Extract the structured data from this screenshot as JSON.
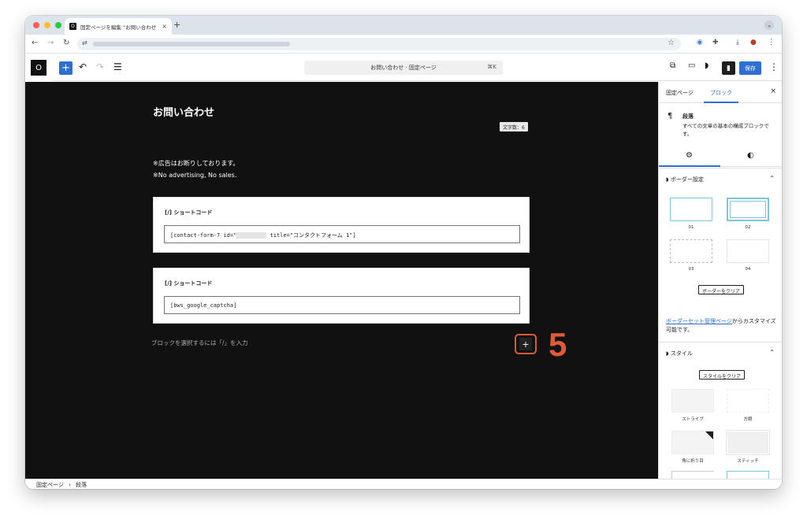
{
  "browser": {
    "tab_title": "固定ページを編集 “お問い合わせ",
    "tab_favicon": "O",
    "new_tab": "+",
    "close_tab": "×"
  },
  "editor": {
    "site_logo": "O",
    "add_block": "+",
    "command_bar": "お問い合わせ · 固定ページ",
    "command_shortcut": "⌘K",
    "save_label": "保存",
    "sidebar_toggle": "▮"
  },
  "canvas": {
    "page_title": "お問い合わせ",
    "word_count": "文字数：6",
    "notice_jp": "※広告はお断りしております。",
    "notice_en": "※No advertising, No sales.",
    "shortcode_blocks": [
      {
        "label": "[/] ショートコード",
        "value_pre": "[contact-form-7 id=\"",
        "value_post": " title=\"コンタクトフォーム 1\"]"
      },
      {
        "label": "[/] ショートコード",
        "value_pre": "[bws_google_captcha]",
        "value_post": ""
      }
    ],
    "block_placeholder": "ブロックを選択するには「/」を入力",
    "inserter_plus": "+",
    "annotation_number": "5"
  },
  "sidebar": {
    "tabs": [
      "固定ページ",
      "ブロック"
    ],
    "active_tab": "ブロック",
    "close": "×",
    "block_name": "段落",
    "block_description": "すべての文章の基本の構成ブロックです。",
    "pilcrow": "¶",
    "settings_tab_icon": "⚙",
    "styles_tab_icon": "◐",
    "border_section": {
      "title": "ボーダー設定",
      "options": [
        "01",
        "02",
        "03",
        "04"
      ],
      "clear_label": "ボーダーをクリア"
    },
    "border_link_text": "ボーダーセット管理ページ",
    "border_link_suffix": "からカスタマイズ可能です。",
    "style_section": {
      "title": "スタイル",
      "clear_label": "スタイルをクリア",
      "options": [
        "ストライプ",
        "方眼",
        "角に折り目",
        "スティッチ"
      ]
    }
  },
  "footer": {
    "breadcrumb": [
      "固定ページ",
      "段落"
    ],
    "separator": "›"
  },
  "colors": {
    "accent": "#2f6fd1",
    "annotation": "#e05a3a",
    "canvas_bg": "#111111"
  }
}
